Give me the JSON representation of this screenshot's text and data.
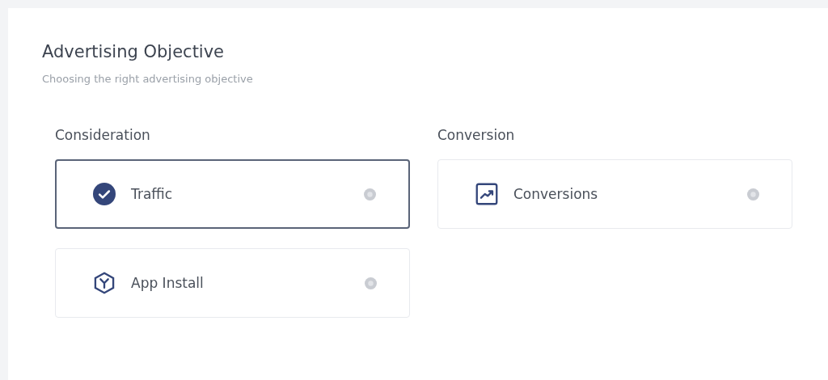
{
  "title": "Advertising Objective",
  "subtitle": "Choosing the right advertising objective",
  "groups": [
    {
      "heading": "Consideration",
      "options": [
        {
          "label": "Traffic",
          "kind": "check",
          "selected": true
        },
        {
          "label": "App Install",
          "kind": "hexagon",
          "selected": false
        }
      ]
    },
    {
      "heading": "Conversion",
      "options": [
        {
          "label": "Conversions",
          "kind": "chart",
          "selected": false
        }
      ]
    }
  ]
}
